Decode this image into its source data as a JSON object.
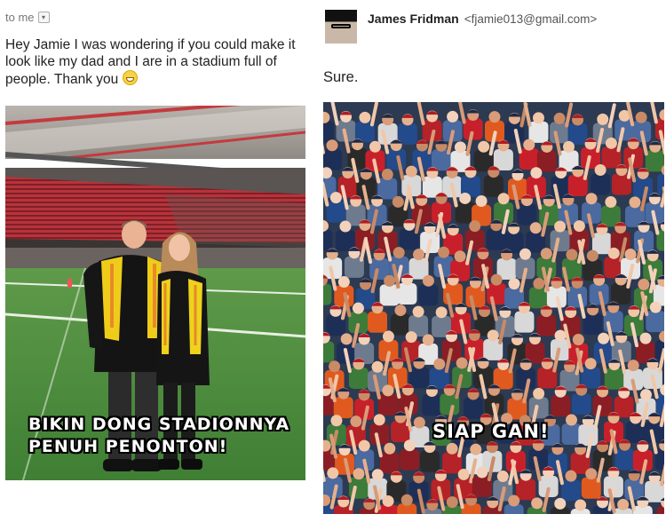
{
  "left": {
    "to_me": "to me",
    "request_text": "Hey Jamie I was wondering if you could make it look like my dad and I are in a stadium full of people. Thank you",
    "caption_line1": "BIKIN DONG STADIONNYA",
    "caption_line2": "PENUH PENONTON!"
  },
  "right": {
    "sender_name": "James Fridman",
    "sender_email": "<fjamie013@gmail.com>",
    "reply_text": "Sure.",
    "caption": "SIAP GAN!"
  },
  "icons": {
    "dropdown": "chevron-down-icon",
    "emoji": "grinning-face-emoji"
  }
}
